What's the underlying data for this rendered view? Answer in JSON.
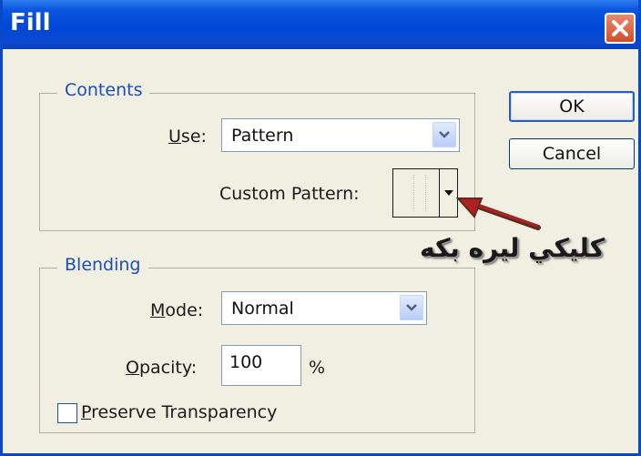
{
  "window": {
    "title": "Fill"
  },
  "icons": {
    "close": "close-icon",
    "dropdown": "chevron-down-icon",
    "annotation_arrow": "arrow-icon"
  },
  "buttons": {
    "ok": "OK",
    "cancel": "Cancel"
  },
  "contents": {
    "legend": "Contents",
    "use_label": "Use:",
    "use_value": "Pattern",
    "custom_pattern_label": "Custom Pattern:"
  },
  "blending": {
    "legend": "Blending",
    "mode_label": "Mode:",
    "mode_value": "Normal",
    "opacity_label": "Opacity:",
    "opacity_value": "100",
    "opacity_unit": "%",
    "preserve_label": "Preserve Transparency",
    "preserve_checked": false
  },
  "annotation": {
    "text": "كليكي ليره بكه"
  },
  "colors": {
    "titlebar": "#0047d8",
    "legend_text": "#1c4eb3",
    "close_button": "#d14d2c",
    "arrow": "#b02020"
  }
}
